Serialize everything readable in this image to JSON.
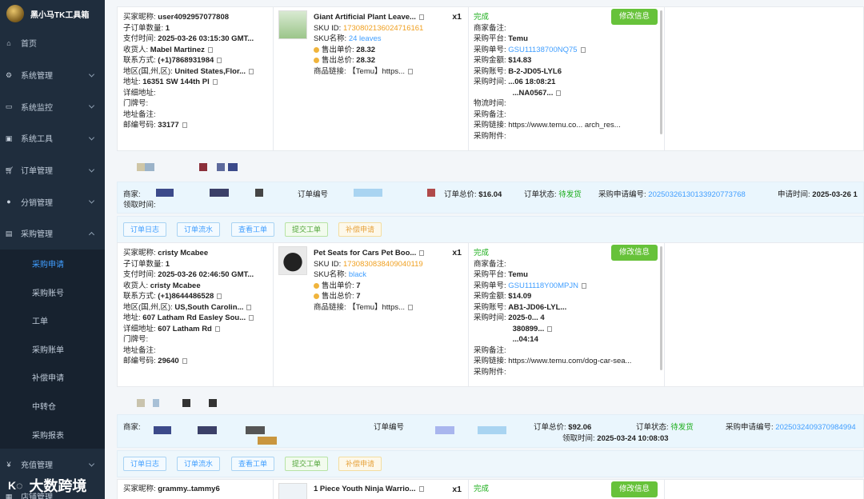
{
  "app": {
    "title": "黑小马TK工具箱"
  },
  "sidebar": {
    "items": [
      {
        "label": "首页",
        "icon": "home-icon"
      },
      {
        "label": "系统管理",
        "icon": "gear-icon"
      },
      {
        "label": "系统监控",
        "icon": "monitor-icon"
      },
      {
        "label": "系统工具",
        "icon": "toolbox-icon"
      },
      {
        "label": "订单管理",
        "icon": "cart-icon"
      },
      {
        "label": "分销管理",
        "icon": "users-icon"
      },
      {
        "label": "采购管理",
        "icon": "purchase-icon"
      }
    ],
    "purchase_sub": [
      "采购申请",
      "采购账号",
      "工单",
      "采购账单",
      "补偿申请",
      "中转仓",
      "采购报表"
    ],
    "more_items": [
      {
        "label": "充值管理",
        "icon": "yen-icon"
      },
      {
        "label": "店铺管理",
        "icon": "store-icon"
      }
    ]
  },
  "labels": {
    "buyer_nick": "买家昵称:",
    "sub_count": "子订单数量:",
    "pay_time": "支付时间:",
    "receiver": "收货人:",
    "contact": "联系方式:",
    "region": "地区(国,州,区):",
    "address": "地址:",
    "detail_address": "详细地址:",
    "door": "门牌号:",
    "addr_note": "地址备注:",
    "zip": "邮编号码:",
    "sku_id": "SKU ID:",
    "sku_name": "SKU名称:",
    "unit_price": "售出单价:",
    "total_price": "售出总价:",
    "goods_link": "商品链接:",
    "merchant_note": "商家备注:",
    "platform": "采购平台:",
    "po_no": "采购单号:",
    "po_amount": "采购金额:",
    "po_account": "采购账号:",
    "po_time": "采购时间:",
    "logistics": "物流时间:",
    "po_note": "采购备注:",
    "po_link": "采购链接:",
    "po_attach": "采购附件:",
    "edit": "修改信息",
    "status_done": "完成",
    "merchant": "商家:",
    "order_no": "订单编号",
    "order_total": "订单总价:",
    "order_status": "订单状态:",
    "apply_no": "采购申请编号:",
    "apply_time": "申请时间:",
    "claim_time": "领取时间:",
    "pending": "待发货"
  },
  "orders": [
    {
      "buyer": "user4092957077808",
      "sub_count": "1",
      "pay_time": "2025-03-26 03:15:30 GMT...",
      "receiver": "Mabel Martinez",
      "phone": "(+1)7868931984",
      "region": "United States,Flor...",
      "address": "16351 SW 144th Pl",
      "detail": "",
      "zip": "33177",
      "product": "Giant Artificial Plant Leave...",
      "qty": "x1",
      "sku_id": "1730802136024716161",
      "sku_name": "24 leaves",
      "unit_price": "28.32",
      "total_price": "28.32",
      "link": "【Temu】https...",
      "platform": "Temu",
      "po_no": "GSU11138700NQ75",
      "amount": "$14.83",
      "account": "B-2-JD05-LYL6",
      "time": "...06 18:08:21",
      "logistics_code": "...NA0567...",
      "po_link": "https://www.temu.co... arch_res...",
      "summary": {
        "order_total": "$16.04",
        "apply_no": "20250326130133920773768",
        "apply_time": "2025-03-26 1"
      }
    },
    {
      "buyer": "cristy Mcabee",
      "sub_count": "1",
      "pay_time": "2025-03-26 02:46:50 GMT...",
      "receiver": "cristy Mcabee",
      "phone": "(+1)8644486528",
      "region": "US,South Carolin...",
      "address": "607 Latham Rd Easley Sou...",
      "detail": "607 Latham Rd",
      "zip": "29640",
      "product": "Pet Seats for Cars Pet Boo...",
      "qty": "x1",
      "sku_id": "1730830838409040119",
      "sku_name": "black",
      "unit_price": "7",
      "total_price": "7",
      "link": "【Temu】https...",
      "platform": "Temu",
      "po_no": "GSU11118Y00MPJN",
      "amount": "$14.09",
      "account": "AB1-JD06-LYL...",
      "time": "2025-0... 4",
      "logistics_code": "380899...",
      "logistics_time": "...04:14",
      "po_link": "https://www.temu.com/dog-car-sea...",
      "summary": {
        "order_total": "$92.06",
        "apply_no": "2025032409370984994",
        "claim_time": "2025-03-24 10:08:03"
      }
    },
    {
      "buyer": "grammy..tammy6",
      "product": "1 Piece Youth Ninja Warrio...",
      "qty": "x1"
    }
  ],
  "action_buttons": [
    "订单日志",
    "订单流水",
    "查看工单",
    "提交工单",
    "补偿申请"
  ],
  "watermark": "大数跨境"
}
